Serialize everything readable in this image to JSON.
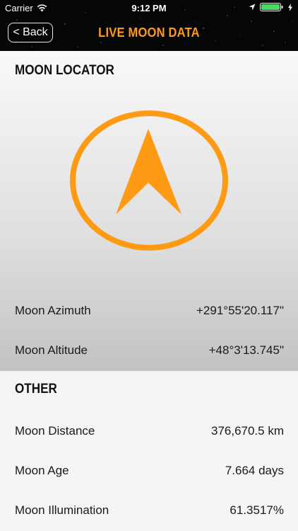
{
  "status_bar": {
    "carrier": "Carrier",
    "time": "9:12 PM"
  },
  "nav": {
    "back_label": "< Back",
    "title": "LIVE MOON DATA"
  },
  "locator": {
    "header": "MOON LOCATOR",
    "rows": [
      {
        "label": "Moon Azimuth",
        "value": "+291°55'20.117\""
      },
      {
        "label": "Moon Altitude",
        "value": "+48°3'13.745\""
      }
    ]
  },
  "other": {
    "header": "OTHER",
    "rows": [
      {
        "label": "Moon Distance",
        "value": "376,670.5 km"
      },
      {
        "label": "Moon Age",
        "value": "7.664 days"
      },
      {
        "label": "Moon Illumination",
        "value": "61.3517%"
      }
    ]
  },
  "colors": {
    "accent": "#ff9a14",
    "nav_background": "#060606"
  },
  "icons": [
    "wifi-icon",
    "location-icon",
    "battery-icon",
    "charging-bolt-icon",
    "compass-arrow-icon"
  ]
}
